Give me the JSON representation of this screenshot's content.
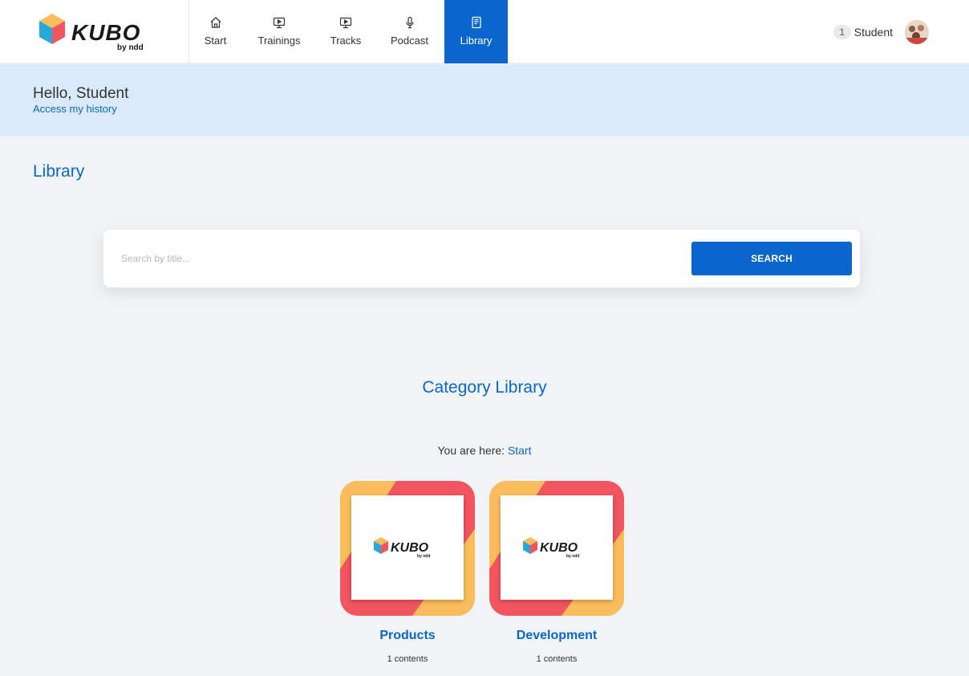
{
  "brand": {
    "name": "KUBO",
    "sub": "by ndd"
  },
  "nav": {
    "items": [
      {
        "label": "Start",
        "icon": "home-icon"
      },
      {
        "label": "Trainings",
        "icon": "monitor-play-icon"
      },
      {
        "label": "Tracks",
        "icon": "monitor-play-icon"
      },
      {
        "label": "Podcast",
        "icon": "microphone-icon"
      },
      {
        "label": "Library",
        "icon": "book-icon",
        "active": true
      }
    ]
  },
  "user": {
    "notification_count": "1",
    "name": "Student"
  },
  "greeting": {
    "hello": "Hello, Student",
    "history_link": "Access my history"
  },
  "page": {
    "title": "Library"
  },
  "search": {
    "placeholder": "Search by title...",
    "button": "SEARCH"
  },
  "category_section": {
    "title": "Category Library",
    "breadcrumb_prefix": "You are here:",
    "breadcrumb_link": "Start"
  },
  "categories": [
    {
      "name": "Products",
      "count": "1 contents"
    },
    {
      "name": "Development",
      "count": "1 contents"
    }
  ],
  "colors": {
    "primary": "#0a66cc",
    "banner": "#dbeafb",
    "background": "#f1f4f7",
    "thumb_red": "#f2555f",
    "thumb_orange": "#fbbd5c"
  }
}
